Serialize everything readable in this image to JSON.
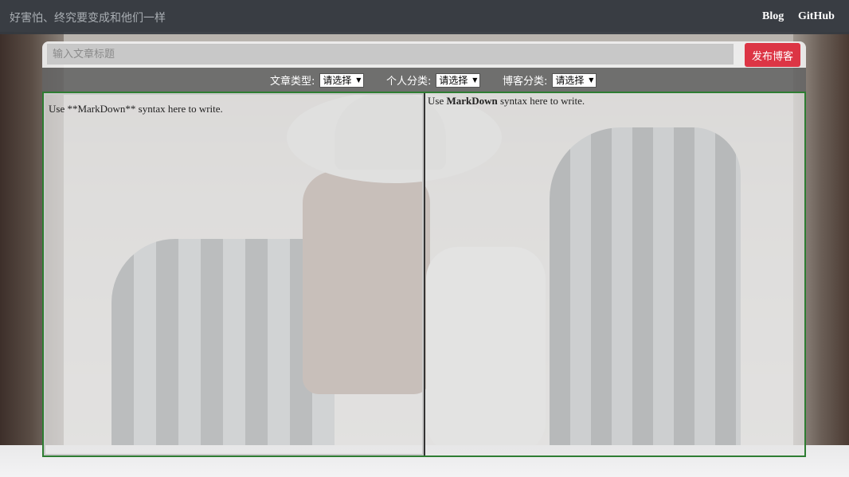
{
  "nav": {
    "brand": "好害怕、终究要变成和他们一样",
    "links": [
      "Blog",
      "GitHub"
    ]
  },
  "editor": {
    "title_placeholder": "输入文章标题",
    "publish_label": "发布博客",
    "filters": [
      {
        "label": "文章类型:",
        "selected": "请选择"
      },
      {
        "label": "个人分类:",
        "selected": "请选择"
      },
      {
        "label": "博客分类:",
        "selected": "请选择"
      }
    ],
    "markdown_text": "Use **MarkDown** syntax here to write.",
    "preview": {
      "prefix": "Use ",
      "bold": "MarkDown",
      "suffix": " syntax here to write."
    }
  },
  "colors": {
    "navbar": "#343a40",
    "publish": "#dc3545",
    "pane_border": "#2e7d32"
  }
}
